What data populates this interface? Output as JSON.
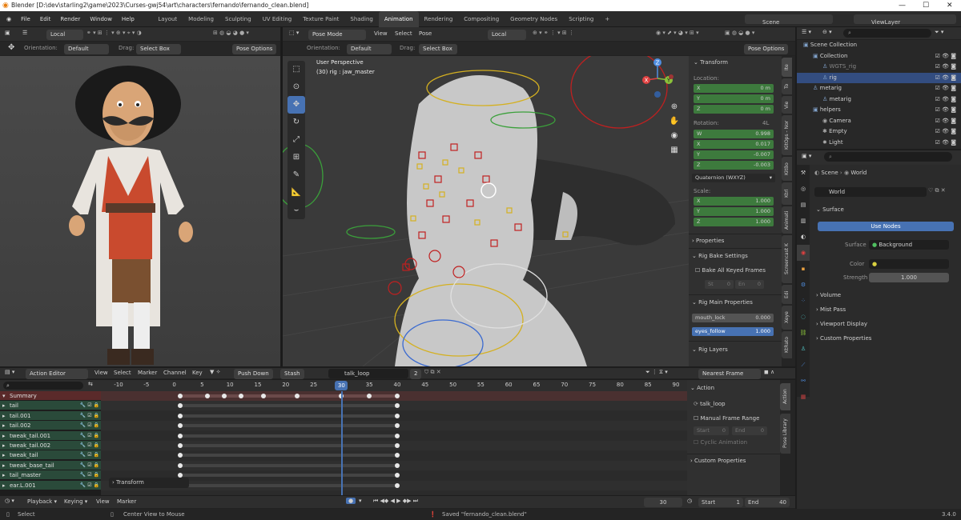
{
  "window": {
    "title": "Blender [D:\\dev\\starling2\\game\\2023\\Curses-gwj54\\art\\characters\\fernando\\fernando_clean.blend]"
  },
  "menus": [
    "File",
    "Edit",
    "Render",
    "Window",
    "Help"
  ],
  "workspaces": [
    "Layout",
    "Modeling",
    "Sculpting",
    "UV Editing",
    "Texture Paint",
    "Shading",
    "Animation",
    "Rendering",
    "Compositing",
    "Geometry Nodes",
    "Scripting"
  ],
  "active_workspace": "Animation",
  "scene": {
    "name": "Scene",
    "view_layer": "ViewLayer"
  },
  "left_view": {
    "orientation_label": "Orientation:",
    "orientation": "Default",
    "drag_label": "Drag:",
    "drag": "Select Box",
    "transform_space": "Local",
    "pose_options": "Pose Options"
  },
  "main_view": {
    "mode": "Pose Mode",
    "menus": [
      "View",
      "Select",
      "Pose"
    ],
    "transform_space": "Local",
    "orientation_label": "Orientation:",
    "orientation": "Default",
    "drag_label": "Drag:",
    "drag": "Select Box",
    "pose_options": "Pose Options",
    "perspective": "User Perspective",
    "active": "(30) rig : jaw_master"
  },
  "gizmo": {
    "x": "X",
    "y": "Y",
    "z": "Z"
  },
  "npanel": {
    "title": "Transform",
    "location_label": "Location:",
    "location": [
      {
        "axis": "X",
        "value": "0 m"
      },
      {
        "axis": "Y",
        "value": "0 m"
      },
      {
        "axis": "Z",
        "value": "0 m"
      }
    ],
    "rotation_label": "Rotation:",
    "rotation_mode_short": "4L",
    "rotation": [
      {
        "axis": "W",
        "value": "0.998"
      },
      {
        "axis": "X",
        "value": "0.017"
      },
      {
        "axis": "Y",
        "value": "-0.007"
      },
      {
        "axis": "Z",
        "value": "-0.003"
      }
    ],
    "rotation_mode": "Quaternion (WXYZ)",
    "scale_label": "Scale:",
    "scale": [
      {
        "axis": "X",
        "value": "1.000"
      },
      {
        "axis": "Y",
        "value": "1.000"
      },
      {
        "axis": "Z",
        "value": "1.000"
      }
    ],
    "properties": "Properties",
    "bake_title": "Rig Bake Settings",
    "bake_all": "Bake All Keyed Frames",
    "bake_start": "St",
    "bake_start_val": "0",
    "bake_end": "En",
    "bake_end_val": "0",
    "main_props_title": "Rig Main Properties",
    "mouth_lock_label": "mouth_lock",
    "mouth_lock": "0.000",
    "eyes_follow_label": "eyes_follow",
    "eyes_follow": "1.000",
    "layers_title": "Rig Layers",
    "tabs": [
      "Ite",
      "To",
      "Vie",
      "KitOps - Nor",
      "KitBo",
      "Ktrl",
      "Animati",
      "Screencast K",
      "Edi",
      "Xeye",
      "KtRato"
    ]
  },
  "outliner": {
    "search_placeholder": "",
    "items": [
      {
        "name": "Scene Collection",
        "indent": 0
      },
      {
        "name": "Collection",
        "indent": 1
      },
      {
        "name": "WGTS_rig",
        "indent": 2,
        "dim": true
      },
      {
        "name": "rig",
        "indent": 2,
        "selected": true
      },
      {
        "name": "metarig",
        "indent": 1
      },
      {
        "name": "metarig",
        "indent": 2
      },
      {
        "name": "helpers",
        "indent": 1
      },
      {
        "name": "Camera",
        "indent": 2
      },
      {
        "name": "Empty",
        "indent": 2
      },
      {
        "name": "Light",
        "indent": 2
      }
    ]
  },
  "properties": {
    "breadcrumb": [
      "Scene",
      "World"
    ],
    "world_name": "World",
    "surface": "Surface",
    "use_nodes": "Use Nodes",
    "surface_label": "Surface",
    "surface_value": "Background",
    "color_label": "Color",
    "strength_label": "Strength",
    "strength_value": "1.000",
    "sections": [
      "Volume",
      "Mist Pass",
      "Viewport Display",
      "Custom Properties"
    ]
  },
  "action_editor": {
    "mode": "Action Editor",
    "menus": [
      "View",
      "Select",
      "Marker",
      "Channel",
      "Key"
    ],
    "push_down": "Push Down",
    "stash": "Stash",
    "action": "talk_loop",
    "users": "2",
    "snapping": "Nearest Frame",
    "frame_ticks": [
      "-10",
      "-5",
      "0",
      "5",
      "10",
      "15",
      "20",
      "25",
      "30",
      "35",
      "40",
      "45",
      "50",
      "55",
      "60",
      "65",
      "70",
      "75",
      "80",
      "85",
      "90"
    ],
    "current_frame": "30",
    "channels": [
      "Summary",
      "tail",
      "tail.001",
      "tail.002",
      "tweak_tail.001",
      "tweak_tail.002",
      "tweak_tail",
      "tweak_base_tail",
      "tail_master",
      "ear.L.001"
    ],
    "transform_popup": "Transform",
    "side": {
      "action_title": "Action",
      "action_name": "talk_loop",
      "manual_range": "Manual Frame Range",
      "start_label": "Start",
      "start_val": "0",
      "end_label": "End",
      "end_val": "0",
      "cyclic": "Cyclic Animation",
      "custom_props": "Custom Properties"
    },
    "side_tabs": [
      "Action",
      "Pose Library"
    ]
  },
  "timeline": {
    "menus": [
      "Playback",
      "Keying",
      "View",
      "Marker"
    ],
    "current": "30",
    "start_label": "Start",
    "start": "1",
    "end_label": "End",
    "end": "40"
  },
  "status": {
    "select": "Select",
    "center": "Center View to Mouse",
    "message": "Saved \"fernando_clean.blend\"",
    "version": "3.4.0"
  }
}
